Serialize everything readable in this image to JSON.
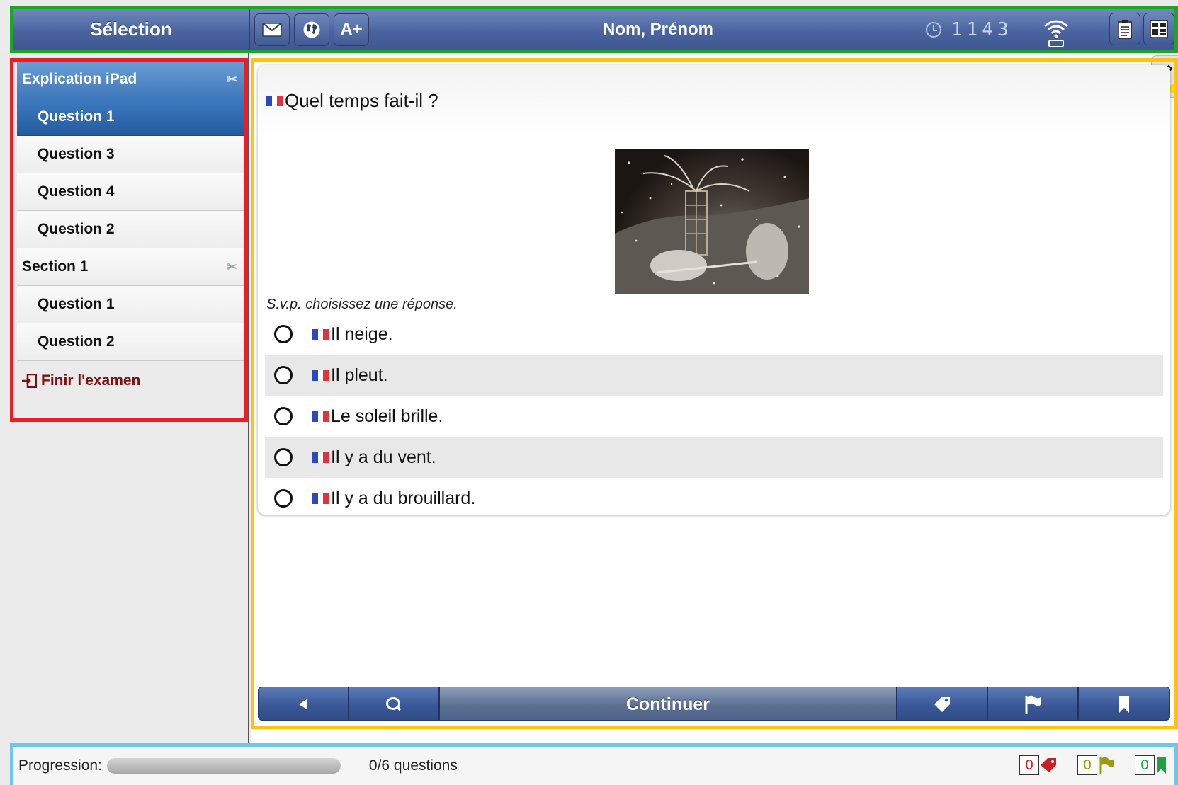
{
  "header": {
    "selection_title": "Sélection",
    "tool_buttons": [
      {
        "icon": "envelope-icon"
      },
      {
        "icon": "globe-icon"
      },
      {
        "label": "A+"
      }
    ],
    "user_name": "Nom, Prénom",
    "timer": "1143"
  },
  "sidebar": {
    "items": [
      {
        "label": "Explication iPad"
      },
      {
        "label": "Question 1"
      },
      {
        "label": "Question 3"
      },
      {
        "label": "Question 4"
      },
      {
        "label": "Question 2"
      },
      {
        "label": "Section 1"
      },
      {
        "label": "Question 1"
      },
      {
        "label": "Question 2"
      }
    ],
    "finish_label": "Finir l'examen"
  },
  "question": {
    "text": "Quel temps fait-il ?",
    "instruction": "S.v.p. choisissez une réponse.",
    "options": [
      "Il neige.",
      "Il pleut.",
      "Le soleil brille.",
      "Il y a du vent.",
      "Il y a du brouillard."
    ]
  },
  "nav": {
    "continue_label": "Continuer"
  },
  "status": {
    "progress_label": "Progression:",
    "progress_fraction": 0,
    "questions_count": "0/6 questions",
    "counters": {
      "tagged": "0",
      "flagged": "0",
      "bookmarked": "0"
    }
  },
  "colors": {
    "header_blue": "#4a64a0",
    "sidebar_active": "#2b64a8",
    "finish_red": "#7b1010",
    "tag_red": "#cc1e28",
    "flag_olive": "#9c9a10",
    "bookmark_green": "#20a040"
  }
}
